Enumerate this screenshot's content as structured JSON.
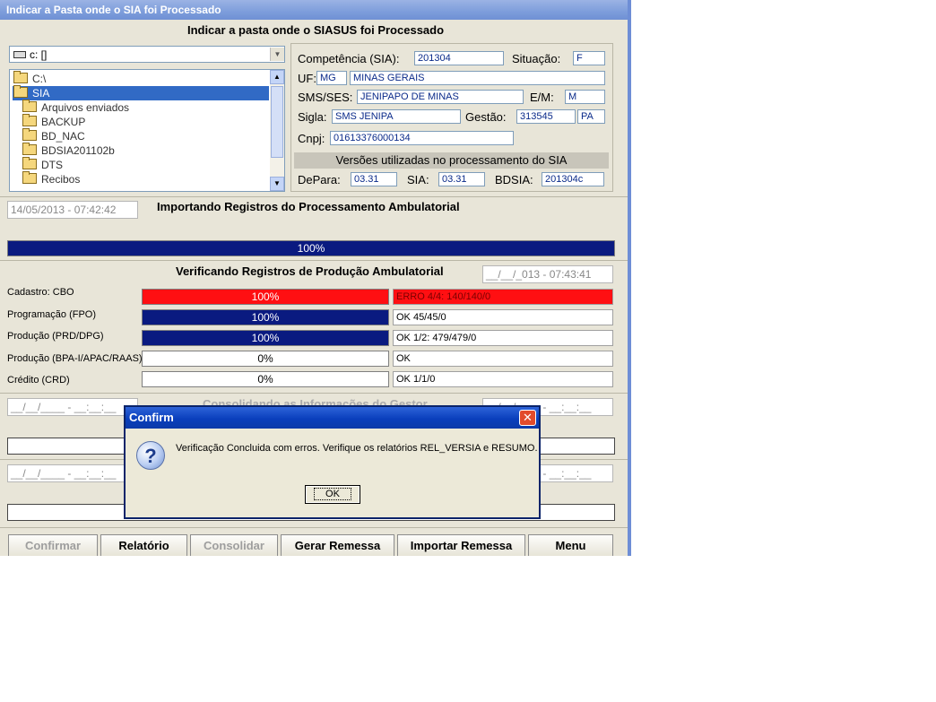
{
  "window": {
    "title": "Indicar a Pasta onde o SIA foi Processado"
  },
  "header": {
    "title": "Indicar a pasta onde o SIASUS foi Processado"
  },
  "drive": {
    "value": "c: []"
  },
  "tree": {
    "root": "C:\\",
    "selected": "SIA",
    "items": [
      "Arquivos enviados",
      "BACKUP",
      "BD_NAC",
      "BDSIA201102b",
      "DTS",
      "Recibos"
    ]
  },
  "info": {
    "competencia_label": "Competência (SIA):",
    "competencia": "201304",
    "situacao_label": "Situação:",
    "situacao": "F",
    "uf_label": "UF:",
    "uf": "MG",
    "uf_name": "MINAS GERAIS",
    "sms_label": "SMS/SES:",
    "sms": "JENIPAPO DE MINAS",
    "em_label": "E/M:",
    "em": "M",
    "sigla_label": "Sigla:",
    "sigla": "SMS JENIPA",
    "gestao_label": "Gestão:",
    "gestao": "313545",
    "gestao_type": "PA",
    "cnpj_label": "Cnpj:",
    "cnpj": "01613376000134",
    "versions_title": "Versões utilizadas no processamento do SIA",
    "depara_label": "DePara:",
    "depara": "03.31",
    "sia_label": "SIA:",
    "sia": "03.31",
    "bdsia_label": "BDSIA:",
    "bdsia": "201304c"
  },
  "import": {
    "timestamp": "14/05/2013 - 07:42:42",
    "title": "Importando Registros do Processamento Ambulatorial",
    "progress_label": "100%",
    "progress": 1.0
  },
  "verify": {
    "title": "Verificando Registros de Produção Ambulatorial",
    "timestamp": "__/__/_013 - 07:43:41",
    "rows": [
      {
        "label": "Cadastro: CBO",
        "pct": "100%",
        "status": "ERRO 4/4: 140/140/0"
      },
      {
        "label": "Programação (FPO)",
        "pct": "100%",
        "status": "OK 45/45/0"
      },
      {
        "label": "Produção (PRD/DPG)",
        "pct": "100%",
        "status": "OK 1/2: 479/479/0"
      },
      {
        "label": "Produção (BPA-I/APAC/RAAS)",
        "pct": "0%",
        "status": "OK"
      },
      {
        "label": "Crédito (CRD)",
        "pct": "0%",
        "status": "OK 1/1/0"
      }
    ]
  },
  "consolidate": {
    "timestamp_left": "__/__/____ - __:__:__",
    "title": "Consolidando as Informações do Gestor",
    "timestamp_right": "__/__/____ - __:__:__"
  },
  "remessa": {
    "timestamp_left": "__/__/____ - __:__:__",
    "timestamp_right": "__/__/____ - __:__:__"
  },
  "buttons": {
    "confirmar": "Confirmar",
    "relatorio": "Relatório",
    "consolidar": "Consolidar",
    "gerar_remessa": "Gerar Remessa",
    "importar_remessa": "Importar Remessa",
    "menu": "Menu"
  },
  "dialog": {
    "title": "Confirm",
    "message": "Verificação Concluida com erros. Verifique os relatórios REL_VERSIA e RESUMO.",
    "ok": "OK"
  },
  "colors": {
    "navy": "#0a1a80",
    "error_red": "#ff0f12",
    "title_blue": "#0a3fbd"
  }
}
